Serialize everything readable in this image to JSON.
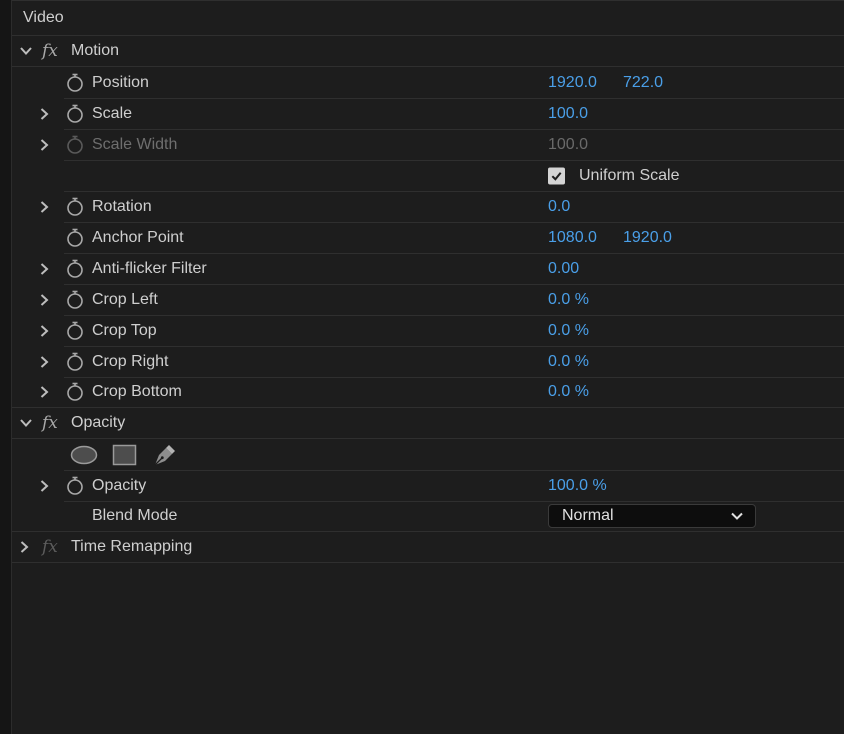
{
  "section": {
    "label": "Video"
  },
  "motion": {
    "label": "Motion",
    "properties": [
      {
        "label": "Position",
        "values": [
          "1920.0",
          "722.0"
        ]
      },
      {
        "label": "Scale",
        "values": [
          "100.0"
        ]
      },
      {
        "label": "Scale Width",
        "values": [
          "100.0"
        ]
      },
      {
        "uniform_scale_label": "Uniform Scale",
        "checked": true
      },
      {
        "label": "Rotation",
        "values": [
          "0.0"
        ]
      },
      {
        "label": "Anchor Point",
        "values": [
          "1080.0",
          "1920.0"
        ]
      },
      {
        "label": "Anti-flicker Filter",
        "values": [
          "0.00"
        ]
      },
      {
        "label": "Crop Left",
        "values": [
          "0.0 %"
        ]
      },
      {
        "label": "Crop Top",
        "values": [
          "0.0 %"
        ]
      },
      {
        "label": "Crop Right",
        "values": [
          "0.0 %"
        ]
      },
      {
        "label": "Crop Bottom",
        "values": [
          "0.0 %"
        ]
      }
    ]
  },
  "opacity": {
    "label": "Opacity",
    "mask_tools": [
      "ellipse-mask-icon",
      "rectangle-mask-icon",
      "pen-mask-icon"
    ],
    "opacity_label": "Opacity",
    "opacity_value": "100.0 %",
    "blend_mode_label": "Blend Mode",
    "blend_mode_value": "Normal"
  },
  "time_remapping": {
    "label": "Time Remapping"
  },
  "colors": {
    "value_blue": "#4a9fe8",
    "background": "#1d1d1d"
  }
}
